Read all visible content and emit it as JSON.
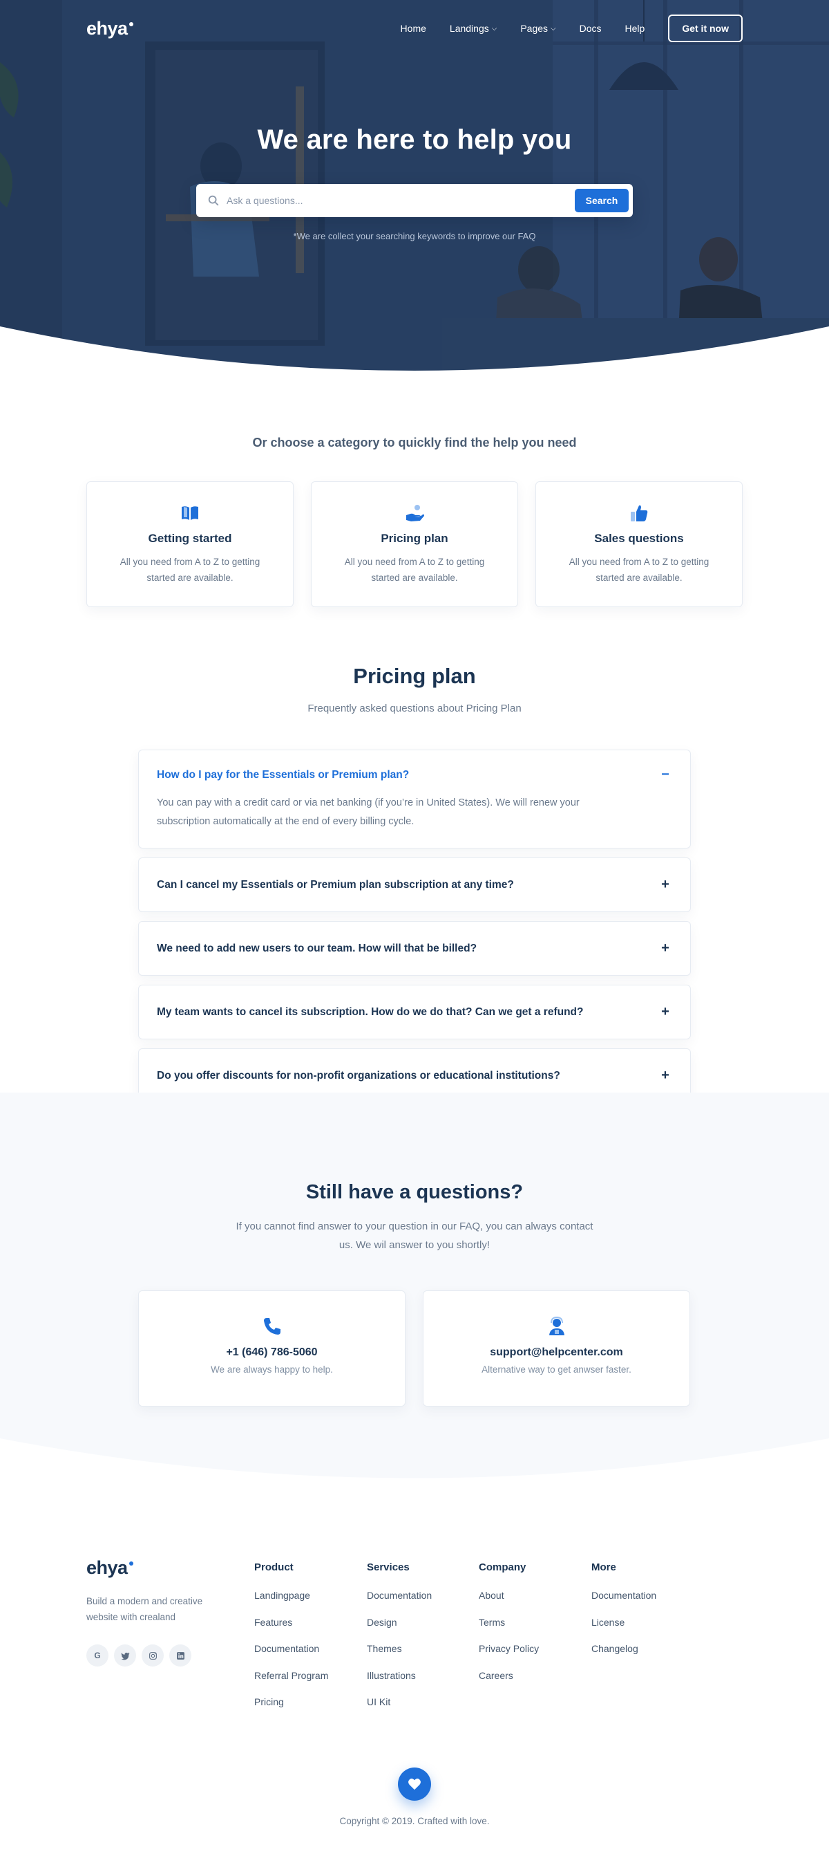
{
  "brand": {
    "logo": "ehya"
  },
  "nav": {
    "links": [
      {
        "label": "Home",
        "has_dropdown": false
      },
      {
        "label": "Landings",
        "has_dropdown": true
      },
      {
        "label": "Pages",
        "has_dropdown": true
      },
      {
        "label": "Docs",
        "has_dropdown": false
      },
      {
        "label": "Help",
        "has_dropdown": false
      }
    ],
    "cta": "Get it now"
  },
  "hero": {
    "title": "We are here to help you",
    "search_placeholder": "Ask a questions...",
    "search_button": "Search",
    "note": "*We are collect your searching keywords to improve our FAQ"
  },
  "categories": {
    "heading": "Or choose a category to quickly find the help you need",
    "items": [
      {
        "icon": "book-icon",
        "title": "Getting started",
        "desc": "All you need from A to Z to getting started are available."
      },
      {
        "icon": "hand-coin-icon",
        "title": "Pricing plan",
        "desc": "All you need from A to Z to getting started are available."
      },
      {
        "icon": "thumbs-up-icon",
        "title": "Sales questions",
        "desc": "All you need from A to Z to getting started are available."
      }
    ]
  },
  "faq": {
    "title": "Pricing plan",
    "subtitle": "Frequently asked questions about Pricing Plan",
    "items": [
      {
        "question": "How do I pay for the Essentials or Premium plan?",
        "answer": "You can pay with a credit card or via net banking (if you’re in United States). We will renew your subscription automatically at the end of every billing cycle.",
        "open": true,
        "toggle": "−"
      },
      {
        "question": "Can I cancel my Essentials or Premium plan subscription at any time?",
        "open": false,
        "toggle": "+"
      },
      {
        "question": "We need to add new users to our team. How will that be billed?",
        "open": false,
        "toggle": "+"
      },
      {
        "question": "My team wants to cancel its subscription. How do we do that? Can we get a refund?",
        "open": false,
        "toggle": "+"
      },
      {
        "question": "Do you offer discounts for non-profit organizations or educational institutions?",
        "open": false,
        "toggle": "+"
      }
    ]
  },
  "contact": {
    "title": "Still have a questions?",
    "text": "If you cannot find answer to your question in our FAQ, you can always contact us. We wil answer to you shortly!",
    "cards": [
      {
        "icon": "phone-icon",
        "title": "+1 (646) 786-5060",
        "desc": "We are always happy to help."
      },
      {
        "icon": "support-agent-icon",
        "title": "support@helpcenter.com",
        "desc": "Alternative way to get anwser faster."
      }
    ]
  },
  "footer": {
    "logo": "ehya",
    "tagline": "Build a modern and creative website with crealand",
    "socials": [
      {
        "icon": "google-icon",
        "glyph": "G"
      },
      {
        "icon": "twitter-icon"
      },
      {
        "icon": "instagram-icon"
      },
      {
        "icon": "linkedin-icon"
      }
    ],
    "columns": [
      {
        "title": "Product",
        "links": [
          "Landingpage",
          "Features",
          "Documentation",
          "Referral Program",
          "Pricing"
        ]
      },
      {
        "title": "Services",
        "links": [
          "Documentation",
          "Design",
          "Themes",
          "Illustrations",
          "UI Kit"
        ]
      },
      {
        "title": "Company",
        "links": [
          "About",
          "Terms",
          "Privacy Policy",
          "Careers"
        ]
      },
      {
        "title": "More",
        "links": [
          "Documentation",
          "License",
          "Changelog"
        ]
      }
    ],
    "copyright": "Copyright © 2019. Crafted with love."
  },
  "colors": {
    "accent": "#1e6fd9",
    "text_dark": "#1c3553",
    "text_muted": "#6b7a8d",
    "hero_overlay": "#2c4670",
    "light_section": "#f7f9fc"
  }
}
